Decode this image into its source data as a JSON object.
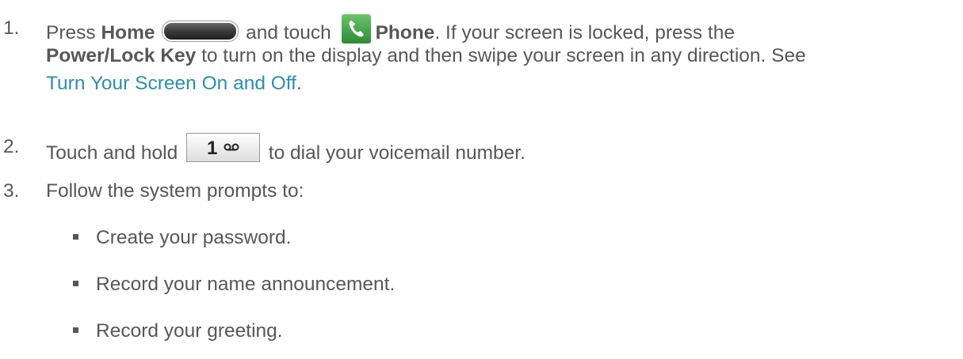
{
  "steps": [
    {
      "number": "1.",
      "press": "Press ",
      "home": "Home",
      "and_touch": " and touch ",
      "phone": "Phone",
      "lock_text": ". If your screen is locked, press the",
      "power_key": "Power/Lock Key",
      "rest": " to turn on the display and then swipe your screen in any direction. See",
      "link": "Turn Your Screen On and Off",
      "end": "."
    },
    {
      "number": "2.",
      "before": "Touch and hold ",
      "key_label": "1",
      "after": " to dial your voicemail number."
    },
    {
      "number": "3.",
      "text": "Follow the system prompts to:"
    }
  ],
  "bullets": [
    "Create your password.",
    "Record your name announcement.",
    "Record your greeting."
  ],
  "icons": {
    "home_button": "home-button-icon",
    "phone": "phone-app-icon",
    "voicemail_key": "voicemail-key-icon"
  },
  "colors": {
    "text": "#575757",
    "link": "#2b8fb0",
    "phone_icon": "#3fa34a"
  }
}
